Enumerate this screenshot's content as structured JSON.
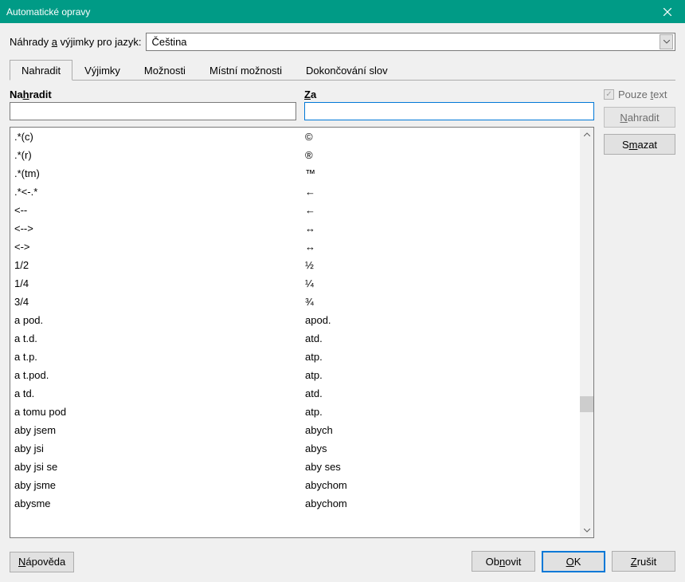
{
  "window": {
    "title": "Automatické opravy"
  },
  "language": {
    "label_pre": "Náhrady ",
    "label_u": "a",
    "label_post": " výjimky pro jazyk:",
    "value": "Čeština"
  },
  "tabs": [
    {
      "label": "Nahradit"
    },
    {
      "label": "Výjimky"
    },
    {
      "label": "Možnosti"
    },
    {
      "label": "Místní možnosti"
    },
    {
      "label": "Dokončování slov"
    }
  ],
  "headers": {
    "replace_pre": "Na",
    "replace_u": "h",
    "replace_post": "radit",
    "with_u": "Z",
    "with_post": "a"
  },
  "text_only": {
    "label_pre": "Pouze ",
    "label_u": "t",
    "label_post": "ext"
  },
  "side": {
    "replace_u": "N",
    "replace_post": "ahradit",
    "delete_pre": "S",
    "delete_u": "m",
    "delete_post": "azat"
  },
  "entries": [
    {
      "a": ".*(c)",
      "b": "©"
    },
    {
      "a": ".*(r)",
      "b": "®"
    },
    {
      "a": ".*(tm)",
      "b": "™"
    },
    {
      "a": ".*<-.*",
      "b": "←"
    },
    {
      "a": "<--",
      "b": "←"
    },
    {
      "a": "<-->",
      "b": "↔"
    },
    {
      "a": "<->",
      "b": "↔"
    },
    {
      "a": "1/2",
      "b": "½"
    },
    {
      "a": "1/4",
      "b": "¼"
    },
    {
      "a": "3/4",
      "b": "¾"
    },
    {
      "a": "a pod.",
      "b": "apod."
    },
    {
      "a": "a t.d.",
      "b": "atd."
    },
    {
      "a": "a t.p.",
      "b": "atp."
    },
    {
      "a": "a t.pod.",
      "b": "atp."
    },
    {
      "a": "a td.",
      "b": "atd."
    },
    {
      "a": "a tomu pod",
      "b": "atp."
    },
    {
      "a": "aby jsem",
      "b": "abych"
    },
    {
      "a": "aby jsi",
      "b": "abys"
    },
    {
      "a": "aby jsi se",
      "b": "aby ses"
    },
    {
      "a": "aby jsme",
      "b": "abychom"
    },
    {
      "a": "abysme",
      "b": "abychom"
    }
  ],
  "footer": {
    "help_u": "N",
    "help_post": "ápověda",
    "reset_pre": "Ob",
    "reset_u": "n",
    "reset_post": "ovit",
    "ok_u": "O",
    "ok_post": "K",
    "cancel_u": "Z",
    "cancel_post": "rušit"
  }
}
